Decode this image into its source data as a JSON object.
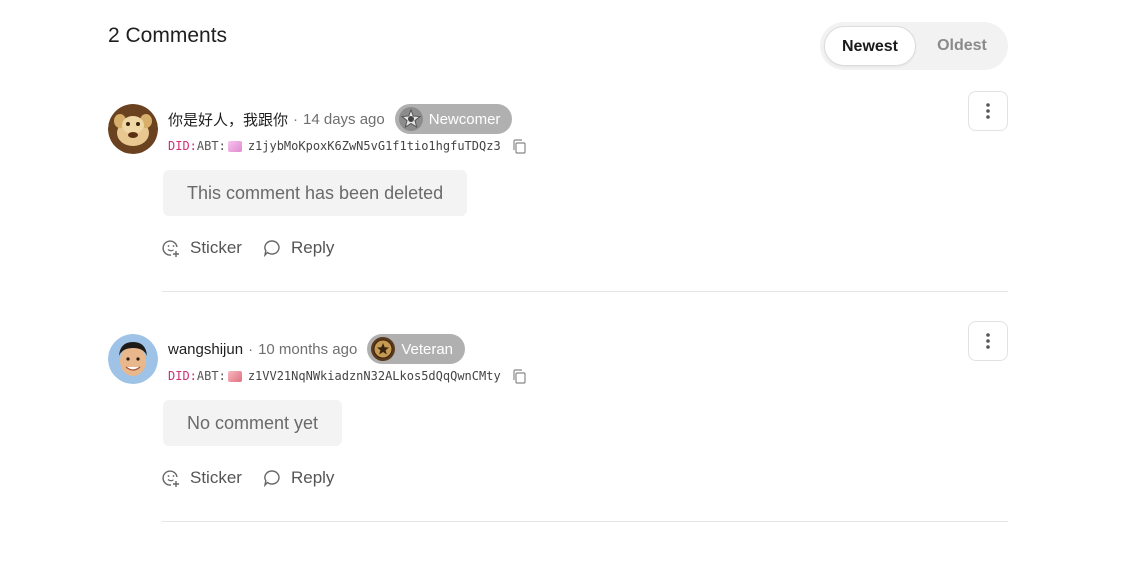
{
  "comments_header": {
    "title": "2 Comments",
    "sort_options": [
      {
        "label": "Newest",
        "active": true
      },
      {
        "label": "Oldest",
        "active": false
      }
    ]
  },
  "comments": [
    {
      "username": "你是好人，我跟你",
      "separator": "·",
      "timestamp": "14 days ago",
      "badge": {
        "label": "Newcomer",
        "icon": "newcomer-badge-icon",
        "color": "#b0b0b0"
      },
      "did": {
        "prefix": "DID:",
        "abt": "ABT:",
        "value": "z1jybMoKpoxK6ZwN5vG1f1tio1hgfuTDQz3",
        "swatch_color": "#f0a8e0"
      },
      "body": "This comment has been deleted",
      "actions": {
        "sticker": "Sticker",
        "reply": "Reply"
      }
    },
    {
      "username": "wangshijun",
      "separator": "·",
      "timestamp": "10 months ago",
      "badge": {
        "label": "Veteran",
        "icon": "veteran-badge-icon",
        "color": "#b0b0b0"
      },
      "did": {
        "prefix": "DID:",
        "abt": "ABT:",
        "value": "z1VV21NqNWkiadznN32ALkos5dQqQwnCMty",
        "swatch_color": "#f29aa6"
      },
      "body": "No comment yet",
      "actions": {
        "sticker": "Sticker",
        "reply": "Reply"
      }
    }
  ]
}
